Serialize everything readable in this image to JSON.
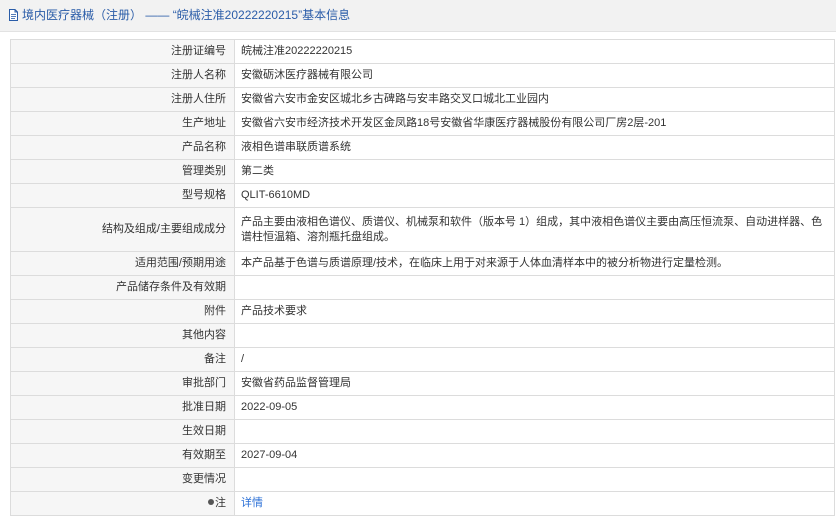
{
  "header": {
    "breadcrumb": "境内医疗器械（注册）",
    "separator": " —— ",
    "title": "“皖械注准20222220215”基本信息"
  },
  "rows": [
    {
      "label": "注册证编号",
      "value": "皖械注准20222220215"
    },
    {
      "label": "注册人名称",
      "value": "安徽砺沐医疗器械有限公司"
    },
    {
      "label": "注册人住所",
      "value": "安徽省六安市金安区城北乡古碑路与安丰路交叉口城北工业园内"
    },
    {
      "label": "生产地址",
      "value": "安徽省六安市经济技术开发区金凤路18号安徽省华康医疗器械股份有限公司厂房2层-201"
    },
    {
      "label": "产品名称",
      "value": "液相色谱串联质谱系统"
    },
    {
      "label": "管理类别",
      "value": "第二类"
    },
    {
      "label": "型号规格",
      "value": "QLIT-6610MD"
    },
    {
      "label": "结构及组成/主要组成成分",
      "value": "产品主要由液相色谱仪、质谱仪、机械泵和软件（版本号 1）组成，其中液相色谱仪主要由高压恒流泵、自动进样器、色谱柱恒温箱、溶剂瓶托盘组成。"
    },
    {
      "label": "适用范围/预期用途",
      "value": "本产品基于色谱与质谱原理/技术，在临床上用于对来源于人体血清样本中的被分析物进行定量检测。"
    },
    {
      "label": "产品储存条件及有效期",
      "value": ""
    },
    {
      "label": "附件",
      "value": "产品技术要求"
    },
    {
      "label": "其他内容",
      "value": ""
    },
    {
      "label": "备注",
      "value": "/"
    },
    {
      "label": "审批部门",
      "value": "安徽省药品监督管理局"
    },
    {
      "label": "批准日期",
      "value": "2022-09-05"
    },
    {
      "label": "生效日期",
      "value": ""
    },
    {
      "label": "有效期至",
      "value": "2027-09-04"
    },
    {
      "label": "变更情况",
      "value": ""
    }
  ],
  "note": {
    "icon": "pin-icon",
    "label": "注",
    "link_text": "详情"
  },
  "colors": {
    "header_text": "#2a5ca8",
    "link": "#2a6fd6",
    "label_bg": "#f6f6f6",
    "border": "#dcdcdc"
  }
}
